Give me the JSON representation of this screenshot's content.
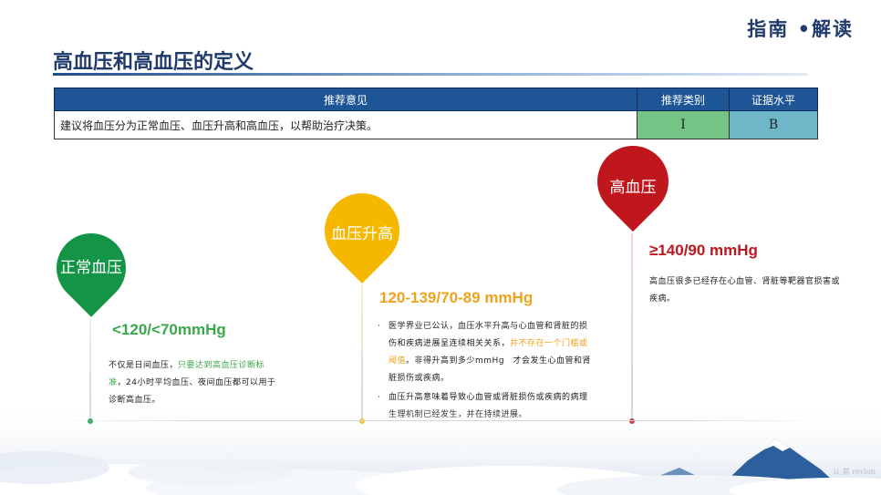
{
  "header": {
    "brand": "指南 •解读",
    "title": "高血压和高血压的定义"
  },
  "table": {
    "headers": [
      "推荐意见",
      "推荐类别",
      "证据水平"
    ],
    "rows": [
      {
        "recommendation": "建议将血压分为正常血压、血压升高和高血压，以帮助治疗决策。",
        "class": "I",
        "level": "B"
      }
    ]
  },
  "categories": [
    {
      "label": "正常血压",
      "value": "<120/<70mmHg",
      "color": "#139447",
      "desc_before": "不仅是日间血压，",
      "desc_highlight": "只要达到高血压诊断标准",
      "desc_after": "，24小时平均血压、夜间血压都可以用于诊断高血压。"
    },
    {
      "label": "血压升高",
      "value": "120-139/70-89 mmHg",
      "color": "#f5b700",
      "bullet": "·",
      "point1_before": "医学界业已公认，血压水平升高与心血管和肾脏的损伤和疾病进展呈连续相关关系，",
      "point1_highlight": "并不存在一个门槛或阈值",
      "point1_after": "。非得升高到多少mmHg　才会发生心血管和肾脏损伤或疾病。",
      "point2": "血压升高意味着导致心血管或肾脏损伤或疾病的病理生理机制已经发生，并在持续进展。"
    },
    {
      "label": "高血压",
      "value": "≥140/90 mmHg",
      "color": "#c0161d",
      "desc": "高血压很多已经存在心血管、肾脏等靶器官损害或疾病。"
    }
  ],
  "footer": {
    "watermark": "认 薪 revion"
  }
}
